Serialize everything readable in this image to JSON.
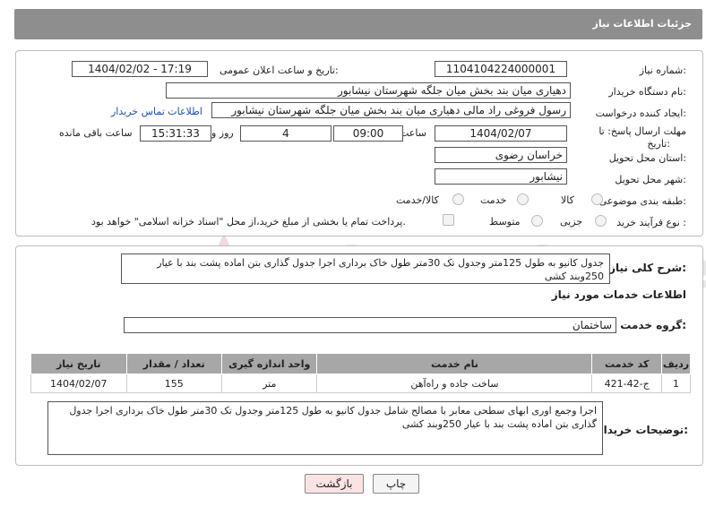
{
  "header": {
    "title": "جزئیات اطلاعات نیاز"
  },
  "watermark": {
    "text": "AriaTender.net"
  },
  "form": {
    "need_number_label": "شماره نیاز:",
    "need_number": "1104104224000001",
    "announce_label": "تاریخ و ساعت اعلان عمومی:",
    "announce_value": "1404/02/02 - 17:19",
    "buyer_label": "نام دستگاه خریدار:",
    "buyer_value": "دهیاری میان بند بخش میان جلگه شهرستان نیشابور",
    "creator_label": "ایجاد کننده درخواست:",
    "creator_value": "رسول فروغی راد مالی دهیاری میان بند بخش میان جلگه شهرستان نیشابور",
    "contact_link": "اطلاعات تماس خریدار",
    "deadline_label_1": "مهلت ارسال پاسخ: تا",
    "deadline_label_2": "تاریخ:",
    "deadline_date": "1404/02/07",
    "time_label": "ساعت",
    "deadline_time": "09:00",
    "days_value": "4",
    "days_label": "روز و",
    "remaining_time": "15:31:33",
    "remaining_label": "ساعت باقی مانده",
    "province_label": "استان محل تحویل:",
    "province_value": "خراسان رضوی",
    "city_label": "شهر محل تحویل:",
    "city_value": "نیشابور",
    "category_label": "طبقه بندی موضوعی:",
    "category_options": [
      "کالا",
      "خدمت",
      "کالا/خدمت"
    ],
    "process_label": "نوع فرآیند خرید :",
    "process_options": [
      "جزیی",
      "متوسط"
    ],
    "process_note": "پرداخت تمام یا بخشی از مبلغ خرید،از محل \"اسناد خزانه اسلامی\" خواهد بود."
  },
  "summary": {
    "label": "شرح کلی نیاز:",
    "text": "جدول کانیو به طول 125متر وجدول تک 30متر طول خاک برداری اجرا جدول گذاری بتن اماده پشت بند با عیار 250وبند کشی"
  },
  "services": {
    "section_title": "اطلاعات خدمات مورد نیاز",
    "group_label": "گروه خدمت:",
    "group_value": "ساختمان",
    "columns": [
      "ردیف",
      "کد خدمت",
      "نام خدمت",
      "واحد اندازه گیری",
      "تعداد / مقدار",
      "تاریخ نیاز"
    ],
    "rows": [
      {
        "row": "1",
        "code": "ج-42-421",
        "name": "ساخت جاده و راه‌آهن",
        "unit": "متر",
        "qty": "155",
        "date": "1404/02/07"
      }
    ]
  },
  "buyer_notes": {
    "label": "توضیحات خریدار:",
    "text": "اجرا وجمع اوری ابهای سطحی معابر با مصالح شامل جدول کانیو به طول 125متر وجدول تک 30متر طول خاک برداری اجرا جدول گذاری بتن اماده پشت بند با عیار 250وبند کشی"
  },
  "buttons": {
    "print": "چاپ",
    "back": "بازگشت"
  }
}
